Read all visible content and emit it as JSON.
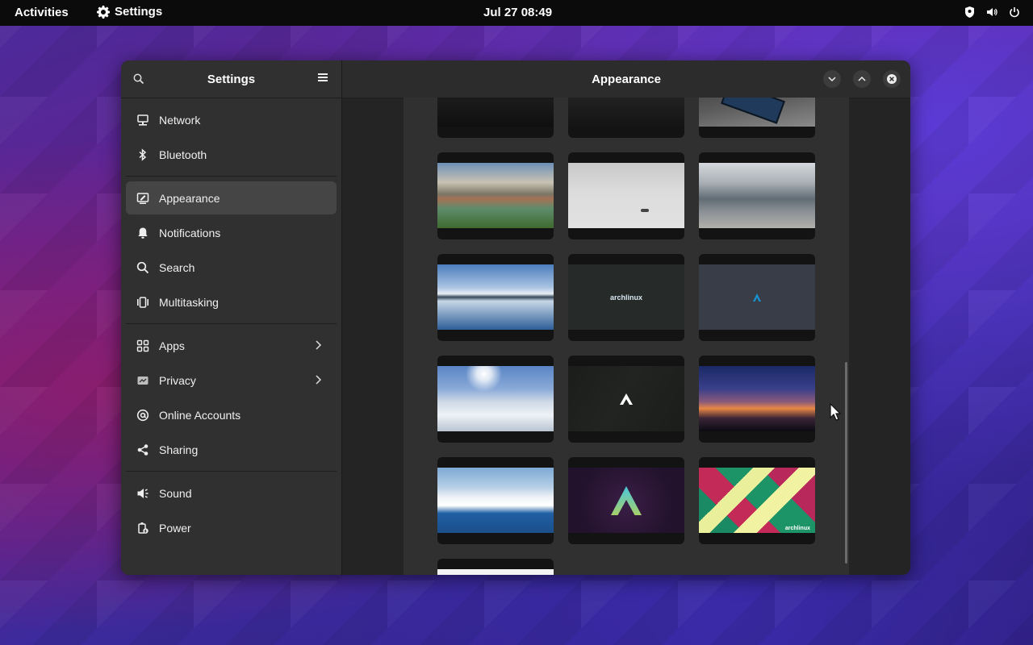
{
  "topbar": {
    "activities": "Activities",
    "app_name": "Settings",
    "clock": "Jul 27  08:49"
  },
  "sidebar": {
    "title": "Settings",
    "items": [
      {
        "label": "Network",
        "icon": "network-icon"
      },
      {
        "label": "Bluetooth",
        "icon": "bluetooth-icon"
      },
      {
        "label": "Appearance",
        "icon": "appearance-icon",
        "active": true
      },
      {
        "label": "Notifications",
        "icon": "bell-icon"
      },
      {
        "label": "Search",
        "icon": "search-icon"
      },
      {
        "label": "Multitasking",
        "icon": "multitasking-icon"
      },
      {
        "label": "Apps",
        "icon": "apps-icon",
        "chevron": true
      },
      {
        "label": "Privacy",
        "icon": "privacy-icon",
        "chevron": true
      },
      {
        "label": "Online Accounts",
        "icon": "at-icon"
      },
      {
        "label": "Sharing",
        "icon": "share-icon"
      },
      {
        "label": "Sound",
        "icon": "speaker-icon"
      },
      {
        "label": "Power",
        "icon": "power-icon"
      }
    ]
  },
  "content": {
    "title": "Appearance"
  },
  "wallpapers": {
    "archlinux_wordmark": "archlinux",
    "accent": "#1793d1"
  }
}
